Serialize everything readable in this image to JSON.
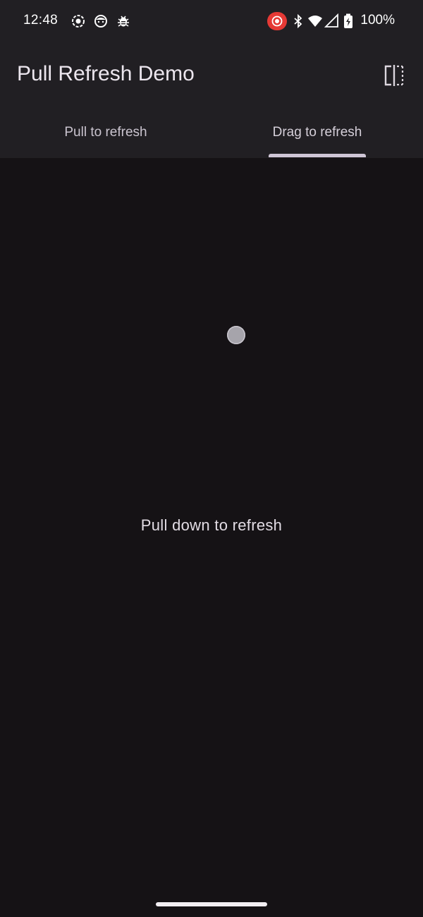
{
  "status_bar": {
    "time": "12:48",
    "battery_text": "100%",
    "icons": [
      "screen-record-icon",
      "face-icon",
      "bug-icon",
      "recording-cast-icon",
      "bluetooth-icon",
      "wifi-icon",
      "signal-icon",
      "battery-charging-icon"
    ],
    "record_badge_color": "#e53935"
  },
  "app_bar": {
    "title": "Pull Refresh Demo",
    "action_icon": "split-view-icon"
  },
  "tabs": [
    {
      "label": "Pull to refresh",
      "selected": false
    },
    {
      "label": "Drag to refresh",
      "selected": true
    }
  ],
  "content": {
    "message": "Pull down to refresh"
  },
  "colors": {
    "top_bar_bg": "#211f23",
    "content_bg": "#151215",
    "indicator": "#cfc6d6"
  }
}
